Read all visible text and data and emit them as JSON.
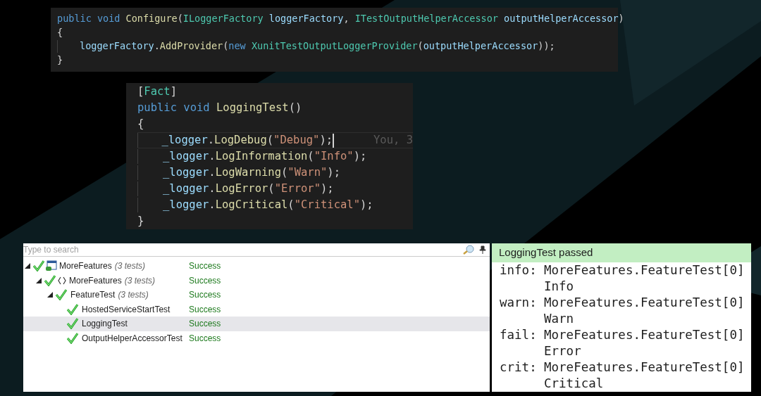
{
  "code_snippets": [
    {
      "lines": [
        {
          "indent": false,
          "current": false,
          "tokens": [
            {
              "color": "#569cd6",
              "t": "public void "
            },
            {
              "color": "#dcdcaa",
              "t": "Configure"
            },
            {
              "t": "("
            },
            {
              "color": "#4ec9b0",
              "t": "ILoggerFactory "
            },
            {
              "color": "#9cdcfe",
              "t": "loggerFactory"
            },
            {
              "t": ", "
            },
            {
              "color": "#4ec9b0",
              "t": "ITestOutputHelperAccessor "
            },
            {
              "color": "#9cdcfe",
              "t": "outputHelperAccessor"
            },
            {
              "t": ")"
            }
          ]
        },
        {
          "indent": false,
          "current": false,
          "tokens": [
            {
              "t": "{"
            }
          ]
        },
        {
          "indent": true,
          "current": false,
          "tokens": [
            {
              "color": "#9cdcfe",
              "t": "loggerFactory"
            },
            {
              "t": "."
            },
            {
              "color": "#dcdcaa",
              "t": "AddProvider"
            },
            {
              "t": "("
            },
            {
              "color": "#569cd6",
              "t": "new "
            },
            {
              "color": "#4ec9b0",
              "t": "XunitTestOutputLoggerProvider"
            },
            {
              "t": "("
            },
            {
              "color": "#9cdcfe",
              "t": "outputHelperAccessor"
            },
            {
              "t": "));"
            }
          ]
        },
        {
          "indent": false,
          "current": false,
          "tokens": [
            {
              "t": "}"
            }
          ]
        }
      ]
    },
    {
      "lines": [
        {
          "indent": false,
          "current": false,
          "tokens": [
            {
              "t": "["
            },
            {
              "color": "#4ec9b0",
              "t": "Fact"
            },
            {
              "t": "]"
            }
          ]
        },
        {
          "indent": false,
          "current": false,
          "tokens": [
            {
              "color": "#569cd6",
              "t": "public void "
            },
            {
              "color": "#dcdcaa",
              "t": "LoggingTest"
            },
            {
              "t": "()"
            }
          ]
        },
        {
          "indent": false,
          "current": false,
          "tokens": [
            {
              "t": "{"
            }
          ]
        },
        {
          "indent": true,
          "current": true,
          "tokens": [
            {
              "color": "#9cdcfe",
              "t": "_logger"
            },
            {
              "t": "."
            },
            {
              "color": "#dcdcaa",
              "t": "LogDebug"
            },
            {
              "t": "("
            },
            {
              "color": "#ce9178",
              "t": "\"Debug\""
            },
            {
              "t": ");"
            }
          ],
          "blame": "You, 3"
        },
        {
          "indent": true,
          "current": false,
          "tokens": [
            {
              "color": "#9cdcfe",
              "t": "_logger"
            },
            {
              "t": "."
            },
            {
              "color": "#dcdcaa",
              "t": "LogInformation"
            },
            {
              "t": "("
            },
            {
              "color": "#ce9178",
              "t": "\"Info\""
            },
            {
              "t": ");"
            }
          ]
        },
        {
          "indent": true,
          "current": false,
          "tokens": [
            {
              "color": "#9cdcfe",
              "t": "_logger"
            },
            {
              "t": "."
            },
            {
              "color": "#dcdcaa",
              "t": "LogWarning"
            },
            {
              "t": "("
            },
            {
              "color": "#ce9178",
              "t": "\"Warn\""
            },
            {
              "t": ");"
            }
          ]
        },
        {
          "indent": true,
          "current": false,
          "tokens": [
            {
              "color": "#9cdcfe",
              "t": "_logger"
            },
            {
              "t": "."
            },
            {
              "color": "#dcdcaa",
              "t": "LogError"
            },
            {
              "t": "("
            },
            {
              "color": "#ce9178",
              "t": "\"Error\""
            },
            {
              "t": ");"
            }
          ]
        },
        {
          "indent": true,
          "current": false,
          "tokens": [
            {
              "color": "#9cdcfe",
              "t": "_logger"
            },
            {
              "t": "."
            },
            {
              "color": "#dcdcaa",
              "t": "LogCritical"
            },
            {
              "t": "("
            },
            {
              "color": "#ce9178",
              "t": "\"Critical\""
            },
            {
              "t": ");"
            }
          ]
        },
        {
          "indent": false,
          "current": false,
          "tokens": [
            {
              "t": "}"
            }
          ]
        }
      ]
    }
  ],
  "test_explorer": {
    "search": {
      "placeholder": "Type to search"
    },
    "tree": [
      {
        "kind": "project",
        "name": "MoreFeatures",
        "count": "(3 tests)",
        "status": "Success",
        "expanded": true,
        "selected": false,
        "children": [
          {
            "kind": "namespace",
            "name": "MoreFeatures",
            "count": "(3 tests)",
            "status": "Success",
            "expanded": true,
            "selected": false,
            "children": [
              {
                "name": "FeatureTest",
                "count": "(3 tests)",
                "status": "Success",
                "expanded": true,
                "selected": false,
                "children": [
                  {
                    "name": "HostedServiceStartTest",
                    "status": "Success",
                    "selected": false
                  },
                  {
                    "name": "LoggingTest",
                    "status": "Success",
                    "selected": true
                  },
                  {
                    "name": "OutputHelperAccessorTest",
                    "status": "Success",
                    "selected": false
                  }
                ]
              }
            ]
          }
        ]
      }
    ]
  },
  "output": {
    "title": "LoggingTest passed",
    "entries": [
      {
        "level": "info:",
        "category": "MoreFeatures.FeatureTest[0]",
        "message": "Info"
      },
      {
        "level": "warn:",
        "category": "MoreFeatures.FeatureTest[0]",
        "message": "Warn"
      },
      {
        "level": "fail:",
        "category": "MoreFeatures.FeatureTest[0]",
        "message": "Error"
      },
      {
        "level": "crit:",
        "category": "MoreFeatures.FeatureTest[0]",
        "message": "Critical"
      }
    ]
  }
}
